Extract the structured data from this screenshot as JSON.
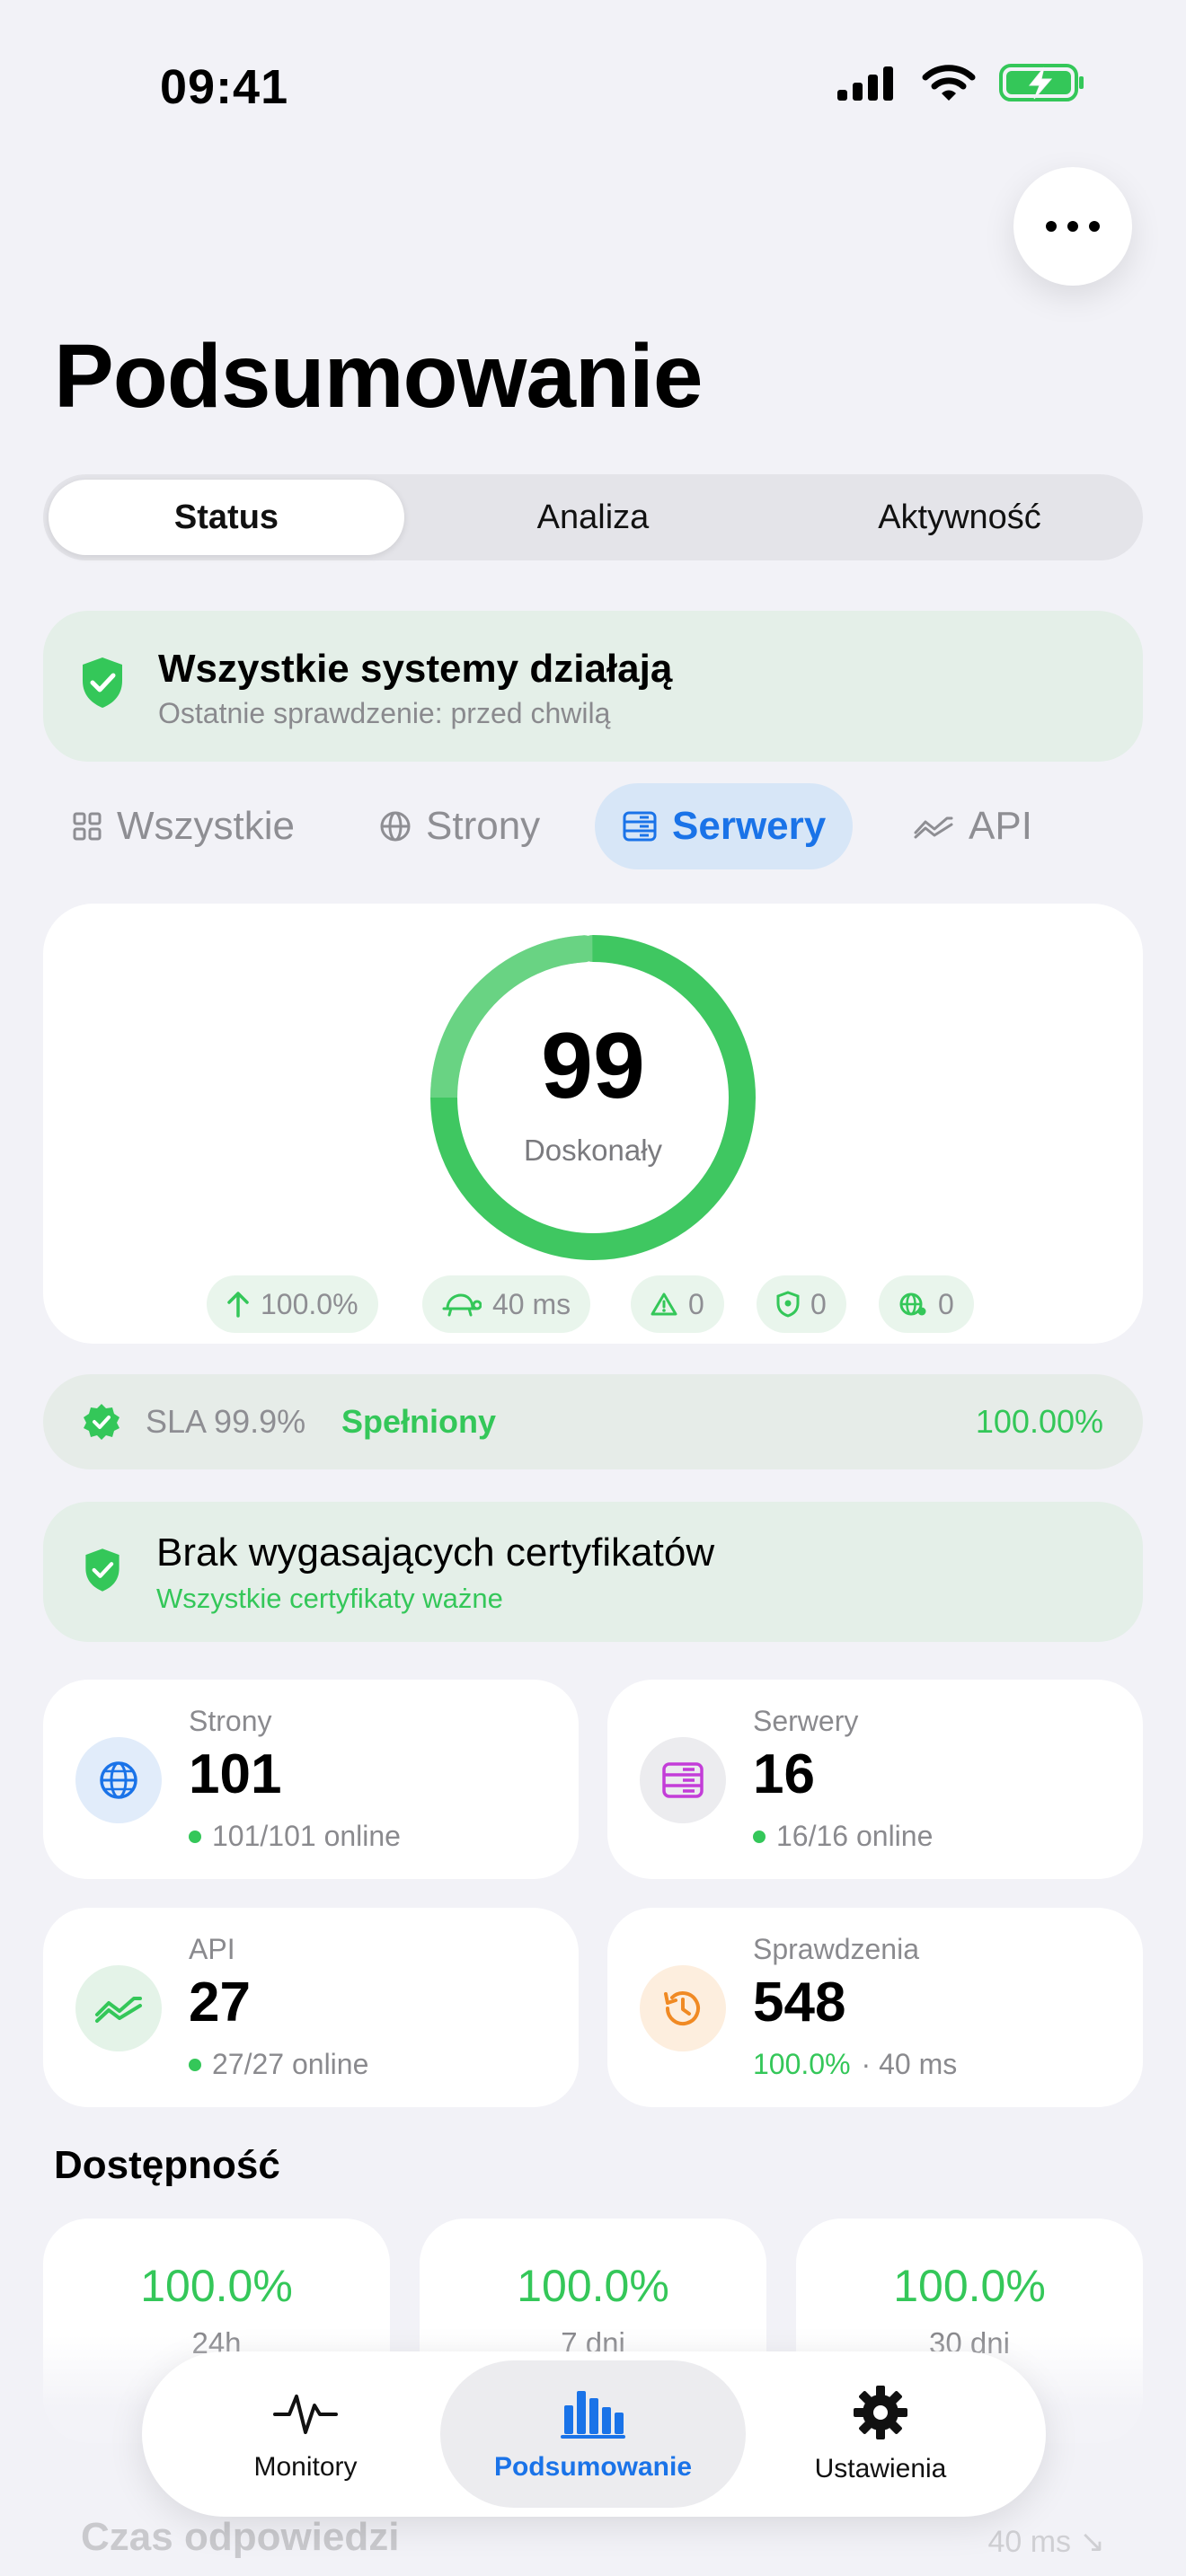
{
  "status_bar": {
    "time": "09:41"
  },
  "header": {
    "title": "Podsumowanie"
  },
  "segments": [
    {
      "label": "Status",
      "active": true
    },
    {
      "label": "Analiza",
      "active": false
    },
    {
      "label": "Aktywność",
      "active": false
    }
  ],
  "status_card": {
    "title": "Wszystkie systemy działają",
    "subtitle": "Ostatnie sprawdzenie: przed chwilą"
  },
  "filters": [
    {
      "label": "Wszystkie",
      "icon": "grid-icon"
    },
    {
      "label": "Strony",
      "icon": "globe-icon"
    },
    {
      "label": "Serwery",
      "icon": "server-icon",
      "active": true
    },
    {
      "label": "API",
      "icon": "api-wave-icon"
    }
  ],
  "score": {
    "value": "99",
    "label": "Doskonały",
    "fraction": 0.99,
    "metrics": [
      {
        "icon": "arrow-up-icon",
        "value": "100.0%"
      },
      {
        "icon": "turtle-icon",
        "value": "40 ms"
      },
      {
        "icon": "warning-icon",
        "value": "0"
      },
      {
        "icon": "shield-icon",
        "value": "0"
      },
      {
        "icon": "globe-network-icon",
        "value": "0"
      }
    ]
  },
  "sla": {
    "label": "SLA 99.9%",
    "state": "Spełniony",
    "percent": "100.00%"
  },
  "certificates": {
    "title": "Brak wygasających certyfikatów",
    "subtitle": "Wszystkie certyfikaty ważne"
  },
  "stats": {
    "pages": {
      "label": "Strony",
      "value": "101",
      "sub": "101/101 online"
    },
    "servers": {
      "label": "Serwery",
      "value": "16",
      "sub": "16/16 online"
    },
    "api": {
      "label": "API",
      "value": "27",
      "sub": "27/27 online"
    },
    "checks": {
      "label": "Sprawdzenia",
      "value": "548",
      "sub_percent": "100.0%",
      "sub_rest": "· 40 ms"
    }
  },
  "availability": {
    "title": "Dostępność",
    "cards": [
      {
        "value": "100.0%",
        "label": "24h"
      },
      {
        "value": "100.0%",
        "label": "7 dni"
      },
      {
        "value": "100.0%",
        "label": "30 dni"
      }
    ]
  },
  "response_time": {
    "title": "Czas odpowiedzi",
    "value": "40 ms ↘"
  },
  "tab_bar": [
    {
      "label": "Monitory",
      "icon": "heartbeat-icon"
    },
    {
      "label": "Podsumowanie",
      "icon": "bar-chart-icon",
      "active": true
    },
    {
      "label": "Ustawienia",
      "icon": "gear-icon"
    }
  ],
  "colors": {
    "accent_blue": "#1a73e8",
    "success_green": "#34c759",
    "server_purple": "#c33dd8",
    "checks_orange": "#f08a24"
  }
}
